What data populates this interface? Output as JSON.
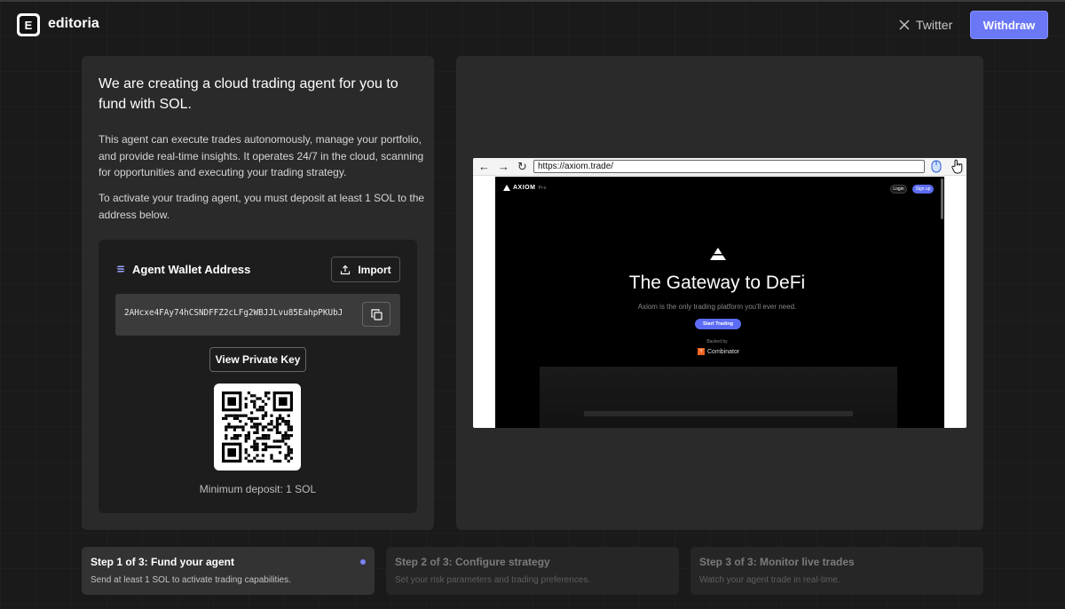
{
  "app": {
    "logo_letter": "E",
    "brand": "editoria"
  },
  "header": {
    "twitter_label": "Twitter",
    "withdraw_label": "Withdraw"
  },
  "colors": {
    "accent": "#6b78f5",
    "background": "#1a1a1a",
    "panel": "#2a2a2a"
  },
  "left_panel": {
    "headline": "We are creating a cloud trading agent for you to fund with SOL.",
    "description": "This agent can execute trades autonomously, manage your portfolio, and provide real-time insights. It operates 24/7 in the cloud, scanning for opportunities and executing your trading strategy.",
    "activation_note": "To activate your trading agent, you must deposit at least 1 SOL to the address below.",
    "wallet": {
      "title": "Agent Wallet Address",
      "import_label": "Import",
      "address": "2AHcxe4FAy74hCSNDFFZ2cLFg2WBJJLvu85EahpPKUbJ",
      "view_private_key_label": "View Private Key",
      "min_deposit": "Minimum deposit: 1 SOL"
    }
  },
  "browser": {
    "url": "https://axiom.trade/",
    "site": {
      "logo": "AXIOM",
      "logo_suffix": "Pro",
      "login_label": "Login",
      "signup_label": "Sign up",
      "headline": "The Gateway to DeFi",
      "subheadline": "Axiom is the only trading platform you'll ever need.",
      "cta_label": "Start Trading",
      "backed_by": "Backed by",
      "backer": "Combinator",
      "backer_mark": "Y"
    }
  },
  "steps": [
    {
      "title": "Step 1 of 3: Fund your agent",
      "description": "Send at least 1 SOL to activate trading capabilities.",
      "active": true
    },
    {
      "title": "Step 2 of 3: Configure strategy",
      "description": "Set your risk parameters and trading preferences.",
      "active": false
    },
    {
      "title": "Step 3 of 3: Monitor live trades",
      "description": "Watch your agent trade in real-time.",
      "active": false
    }
  ]
}
